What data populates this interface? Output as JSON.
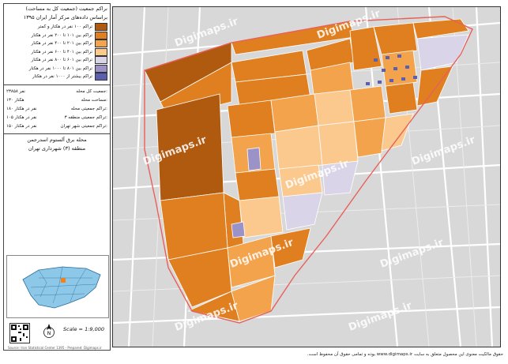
{
  "sidebar": {
    "title_line1": "نراکم جمعیت (جمعیت کل به مساحت)",
    "title_line2": "براساس داده‌های مرکز آمار ایران ۱۳۹۵",
    "legend": [
      {
        "label": "تراکم ۱۰۰ نفر در هکتار و کمتر",
        "color": "#b05a10"
      },
      {
        "label": "تراکم بین ۱۰۱ تا ۲۰۰ نفر در هکتار",
        "color": "#e07f1f"
      },
      {
        "label": "تراکم بین ۲۰۱ تا ۴۰۰ نفر در هکتار",
        "color": "#f3a34c"
      },
      {
        "label": "تراکم بین ۴۰۱ تا ۶۰۰ نفر در هکتار",
        "color": "#fbc98e"
      },
      {
        "label": "تراکم بین ۶۰۱ تا ۸۰۰ نفر در هکتار",
        "color": "#d9d4e8"
      },
      {
        "label": "تراکم بین ۸۰۱ تا ۱۰۰۰ نفر در هکتار",
        "color": "#9b93c7"
      },
      {
        "label": "تراکم بیشتر از ۱۰۰۰ نفر در هکتار",
        "color": "#5a5fb0"
      }
    ],
    "stats": [
      {
        "label": "جمعیت کل محله:",
        "value": "۲۳۸۵۸ نفر"
      },
      {
        "label": "مساحت محله:",
        "value": "۱۳۰ هکتار"
      },
      {
        "label": "تراکم جمعیتی محله:",
        "value": "۱۸۰ نفر در هکتار"
      },
      {
        "label": "تراکم جمعیتی منطقه ۳:",
        "value": "۱۰۵ نفر در هکتار"
      },
      {
        "label": "تراکم جمعیتی شهر تهران:",
        "value": "۱۵۰ نفر در هکتار"
      }
    ],
    "place_line1": "محله برق آلستوم اسدرجمن",
    "place_line2": "منطقه (۳) شهرداری تهران",
    "scale": "Scale = 1:9,000",
    "north_label": "N",
    "credit": "Source: Iran Statistical Center 1395 - Prepared: Digimaps.ir"
  },
  "map": {
    "watermark": "Digimaps.ir",
    "colors": {
      "background": "#d8d8d8",
      "street": "#ffffff",
      "boundary": "#e8605a"
    }
  },
  "footer": "حقوق مالکیت معنوی این محصول متعلق به سایت www.digimaps.ir بوده و تمامی حقوق آن محفوظ است."
}
